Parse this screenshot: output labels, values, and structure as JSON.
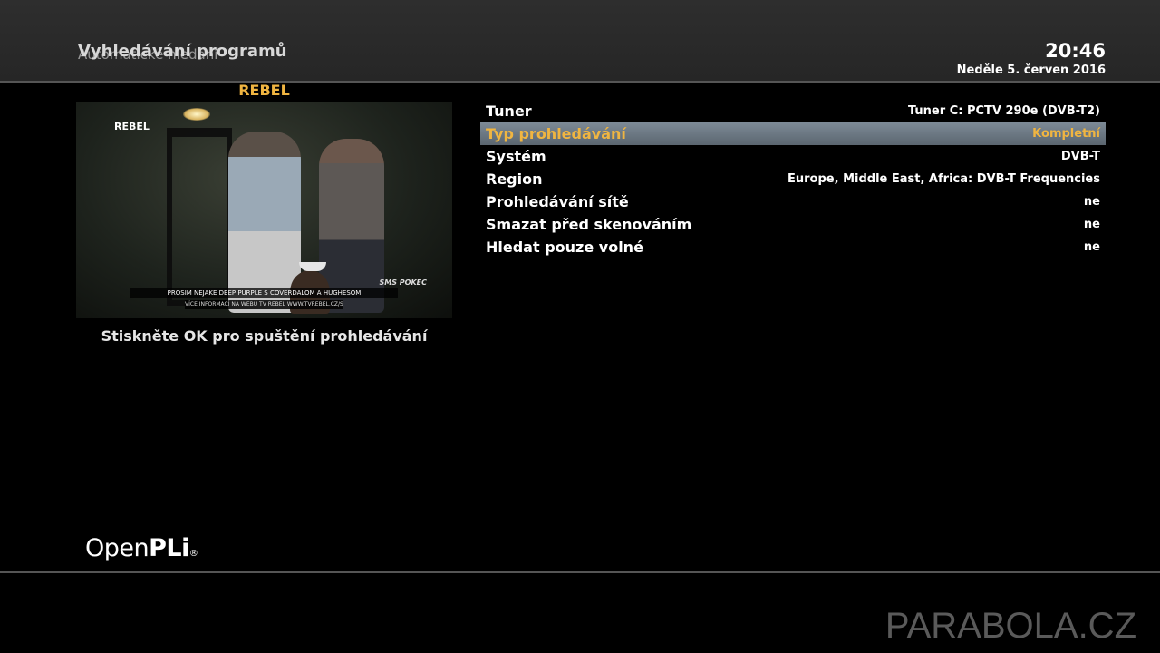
{
  "header": {
    "title": "Vyhledávání programů",
    "title_overlay": "Automatické hledání",
    "clock": "20:46",
    "date": "Neděle  5. červen 2016"
  },
  "preview": {
    "channel_name": "REBEL",
    "logo_text": "REBEL",
    "sms_text": "SMS POKEC",
    "ticker_text": "PROSIM NEJAKE DEEP PURPLE S COVERDALOM A HUGHESOM",
    "ticker_sub": "VÍCE INFORMACÍ NA WEBU TV REBEL WWW.TVREBEL.CZ/SMS"
  },
  "hint": "Stiskněte OK pro spuštění prohledávání",
  "menu": {
    "items": [
      {
        "label": "Tuner",
        "value": "Tuner C: PCTV 290e (DVB-T2)"
      },
      {
        "label": "Typ prohledávání",
        "value": "Kompletní"
      },
      {
        "label": "Systém",
        "value": "DVB-T"
      },
      {
        "label": "Region",
        "value": "Europe, Middle East, Africa: DVB-T Frequencies"
      },
      {
        "label": "Prohledávání sítě",
        "value": "ne"
      },
      {
        "label": "Smazat před skenováním",
        "value": "ne"
      },
      {
        "label": "Hledat pouze volné",
        "value": "ne"
      }
    ],
    "selected_index": 1
  },
  "brand": {
    "part1": "Open",
    "part2": "PLi",
    "mark": "®"
  },
  "watermark": "PARABOLA.CZ",
  "colors": {
    "accent": "#f0b541",
    "selection_bar": "#6c7883",
    "header_bg": "#2a2a2a"
  }
}
